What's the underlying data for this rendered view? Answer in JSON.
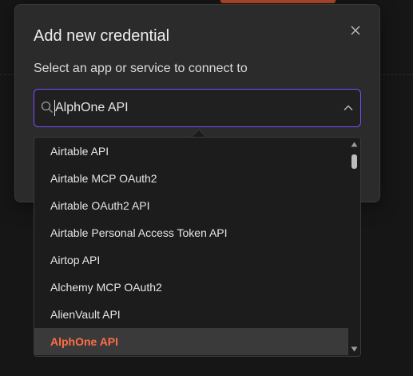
{
  "modal": {
    "title": "Add new credential",
    "subtitle": "Select an app or service to connect to",
    "close_icon": "close-icon"
  },
  "select": {
    "value": "AlphOne API",
    "search_icon": "search-icon",
    "chevron_icon": "chevron-up-icon",
    "focus_color": "#7c4dff"
  },
  "dropdown": {
    "items": [
      {
        "label": "Airtable API"
      },
      {
        "label": "Airtable MCP OAuth2"
      },
      {
        "label": "Airtable OAuth2 API"
      },
      {
        "label": "Airtable Personal Access Token API"
      },
      {
        "label": "Airtop API"
      },
      {
        "label": "Alchemy MCP OAuth2"
      },
      {
        "label": "AlienVault API"
      },
      {
        "label": "AlphOne API"
      }
    ],
    "selected_index": 7,
    "selected_color": "#ff6d45"
  },
  "colors": {
    "accent": "#ff6d45",
    "background": "#161616",
    "modal_bg": "#2b2b2b"
  }
}
